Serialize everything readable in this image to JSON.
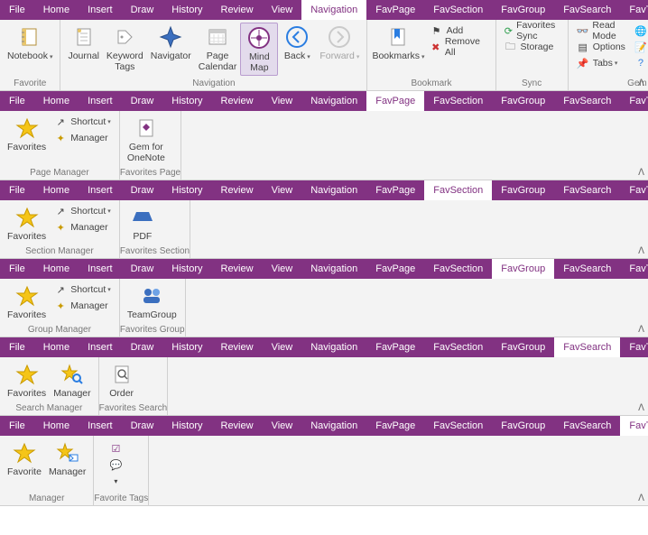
{
  "tabs": {
    "file": "File",
    "home": "Home",
    "insert": "Insert",
    "draw": "Draw",
    "history": "History",
    "review": "Review",
    "view": "View",
    "navigation": "Navigation",
    "favpage": "FavPage",
    "favsection": "FavSection",
    "favgroup": "FavGroup",
    "favsearch": "FavSearch",
    "favtag": "FavTag"
  },
  "nav": {
    "notebook": "Notebook",
    "journal": "Journal",
    "keyword": "Keyword\nTags",
    "navigator": "Navigator",
    "pagecal": "Page\nCalendar",
    "mindmap": "Mind\nMap",
    "back": "Back",
    "forward": "Forward",
    "bookmarks": "Bookmarks",
    "add": "Add",
    "removeall": "Remove All",
    "favsync": "Favorites Sync",
    "storage": "Storage",
    "readmode": "Read Mode",
    "options": "Options",
    "tabsbtn": "Tabs",
    "language": "Language",
    "register": "Register",
    "help": "Help",
    "g_favorite": "Favorite",
    "g_navigation": "Navigation",
    "g_bookmark": "Bookmark",
    "g_sync": "Sync",
    "g_gem": "Gem"
  },
  "favpage": {
    "favorites": "Favorites",
    "shortcut": "Shortcut",
    "manager": "Manager",
    "gem": "Gem for\nOneNote",
    "g_pagem": "Page Manager",
    "g_favp": "Favorites Page"
  },
  "favsection": {
    "favorites": "Favorites",
    "shortcut": "Shortcut",
    "manager": "Manager",
    "pdf": "PDF",
    "g_sectm": "Section Manager",
    "g_favs": "Favorites Section"
  },
  "favgroup": {
    "favorites": "Favorites",
    "shortcut": "Shortcut",
    "manager": "Manager",
    "team": "TeamGroup",
    "g_groupm": "Group Manager",
    "g_favg": "Favorites Group"
  },
  "favsearch": {
    "favorites": "Favorites",
    "manager": "Manager",
    "order": "Order",
    "g_searchm": "Search Manager",
    "g_favs": "Favorites Search"
  },
  "favtag": {
    "favorite": "Favorite",
    "manager": "Manager",
    "g_manager": "Manager",
    "g_favt": "Favorite Tags"
  }
}
